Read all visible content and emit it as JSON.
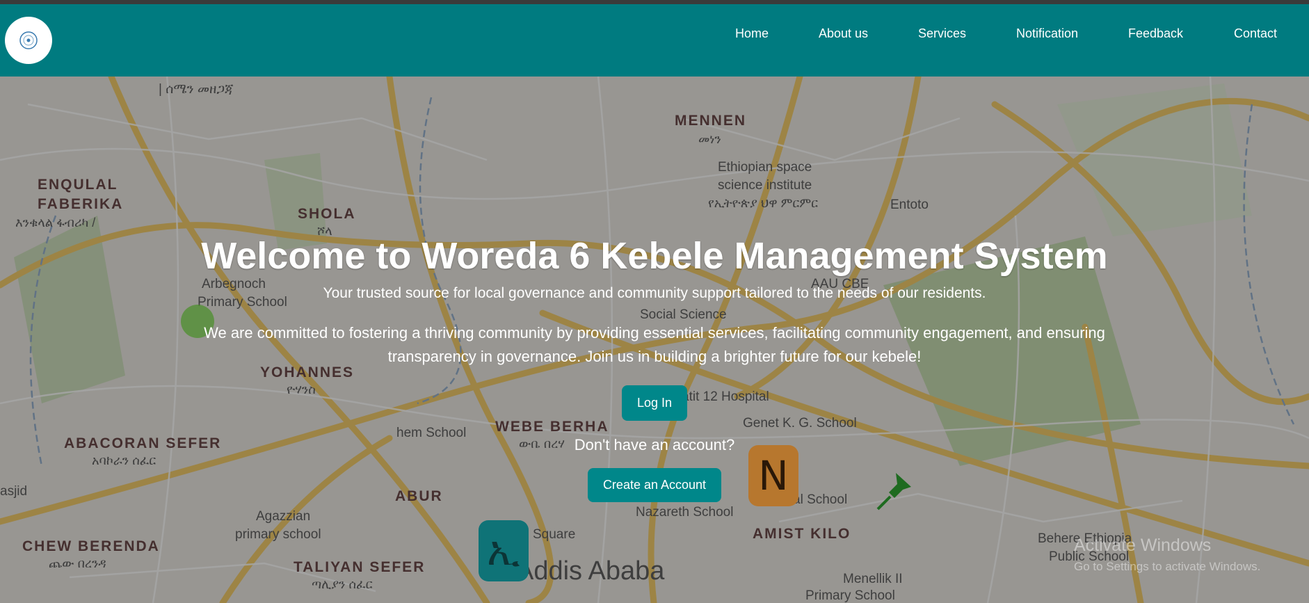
{
  "nav": {
    "items": [
      "Home",
      "About us",
      "Services",
      "Notification",
      "Feedback",
      "Contact"
    ]
  },
  "hero": {
    "title": "Welcome to Woreda 6 Kebele Management System",
    "tagline": "Your trusted source for local governance and community support tailored to the needs of our residents.",
    "description": "We are committed to fostering a thriving community by providing essential services, facilitating community engagement, and ensuring transparency in governance. Join us in building a brighter future for our kebele!",
    "login_label": "Log In",
    "no_account": "Don't have an account?",
    "create_label": "Create an Account"
  },
  "map_labels": {
    "shimelis": "| ሰሜን መዘጋጃ",
    "mennen": "MENNEN",
    "mennen_am": "መነን",
    "space1": "Ethiopian space",
    "space2": "science institute",
    "space3": "የኢትዮጵያ ህዋ ምርምር",
    "entoto": "Entoto",
    "enqulal1": "ENQULAL",
    "enqulal2": "FABERIKA",
    "enqulal_am": "እንቁላል ፋብሪካ /",
    "shola": "SHOLA",
    "shola_am": "ሾላ",
    "arbegnoch1": "Arbegnoch",
    "arbegnoch2": "Primary School",
    "aau": "AAU CBE",
    "social": "Social Science",
    "yohannes": "YOHANNES",
    "yohannes_am": "ዮሃንስ",
    "hospital": "atit 12 Hospital",
    "genet": "Genet K. G. School",
    "webe": "WEBE BERHA",
    "webe_am": "ውቤ በረሃ",
    "hem": "hem School",
    "abacoran": "ABACORAN SEFER",
    "abacoran_am": "አባኮራን ሰፈር",
    "abur": "ABUR",
    "agazzian1": "Agazzian",
    "agazzian2": "primary school",
    "square": "Square",
    "nazareth": "Nazareth School",
    "amist": "AMIST KILO",
    "chew": "CHEW BERENDA",
    "chew_am": "ጨው በረንዳ",
    "taliyan": "TALIYAN SEFER",
    "taliyan_am": "ጣሊያን ሰፈር",
    "addis": "Addis Ababa",
    "menelik1": "Menellik II",
    "menelik2": "Primary School",
    "behere1": "Behere Ethiopia",
    "behere2": "Public School",
    "masjid": "asjid",
    "nechal": "al School"
  },
  "pins": {
    "left_glyph": "ኢ",
    "right_glyph": "N"
  },
  "watermark": {
    "line1": "Activate Windows",
    "line2": "Go to Settings to activate Windows."
  },
  "colors": {
    "navbar": "#007b80",
    "button": "#00878a"
  }
}
